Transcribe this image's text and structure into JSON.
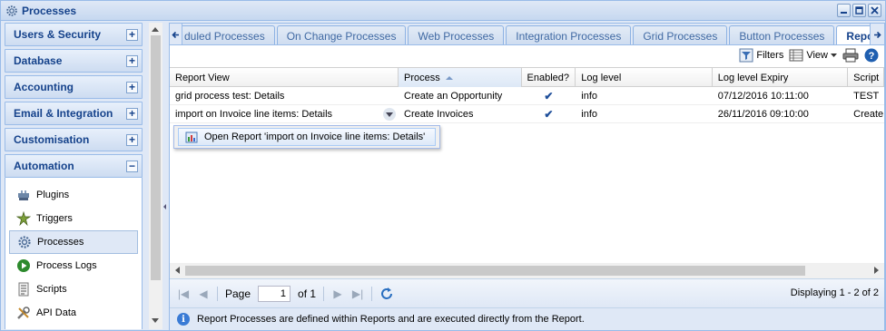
{
  "window": {
    "title": "Processes",
    "icon": "gear-icon"
  },
  "sidebar": {
    "sections": [
      {
        "label": "Users & Security",
        "toggle": "+"
      },
      {
        "label": "Database",
        "toggle": "+"
      },
      {
        "label": "Accounting",
        "toggle": "+"
      },
      {
        "label": "Email & Integration",
        "toggle": "+"
      },
      {
        "label": "Customisation",
        "toggle": "+"
      },
      {
        "label": "Automation",
        "toggle": "−"
      }
    ],
    "items": [
      {
        "label": "Plugins",
        "icon": "plugin-icon"
      },
      {
        "label": "Triggers",
        "icon": "trigger-icon"
      },
      {
        "label": "Processes",
        "icon": "gear-icon",
        "active": true
      },
      {
        "label": "Process Logs",
        "icon": "play-icon"
      },
      {
        "label": "Scripts",
        "icon": "script-icon"
      },
      {
        "label": "API Data",
        "icon": "tools-icon"
      }
    ]
  },
  "tabs": [
    {
      "label": "duled Processes"
    },
    {
      "label": "On Change Processes"
    },
    {
      "label": "Web Processes"
    },
    {
      "label": "Integration Processes"
    },
    {
      "label": "Grid Processes"
    },
    {
      "label": "Button Processes"
    },
    {
      "label": "Report Processes",
      "active": true
    }
  ],
  "toolbar": {
    "filters_label": "Filters",
    "view_label": "View"
  },
  "grid": {
    "columns": [
      "Report View",
      "Process",
      "Enabled?",
      "Log level",
      "Log level Expiry",
      "Script"
    ],
    "rows": [
      {
        "report_view": "grid process test: Details",
        "process": "Create an Opportunity",
        "enabled": "✔",
        "log_level": "info",
        "expiry": "07/12/2016 10:11:00",
        "script": "TEST"
      },
      {
        "report_view": "import on Invoice line items: Details",
        "process": "Create Invoices",
        "enabled": "✔",
        "log_level": "info",
        "expiry": "26/11/2016 09:10:00",
        "script": "Create"
      }
    ]
  },
  "context_menu": {
    "label": "Open Report 'import on Invoice line items: Details'"
  },
  "pager": {
    "page_label": "Page",
    "page_value": "1",
    "of_label": "of 1",
    "display_text": "Displaying 1 - 2 of 2"
  },
  "info": {
    "text": "Report Processes are defined within Reports and are executed directly from the Report."
  },
  "colors": {
    "accent": "#15428b",
    "border": "#99bbe8",
    "panel_bg": "#dfe8f6"
  }
}
